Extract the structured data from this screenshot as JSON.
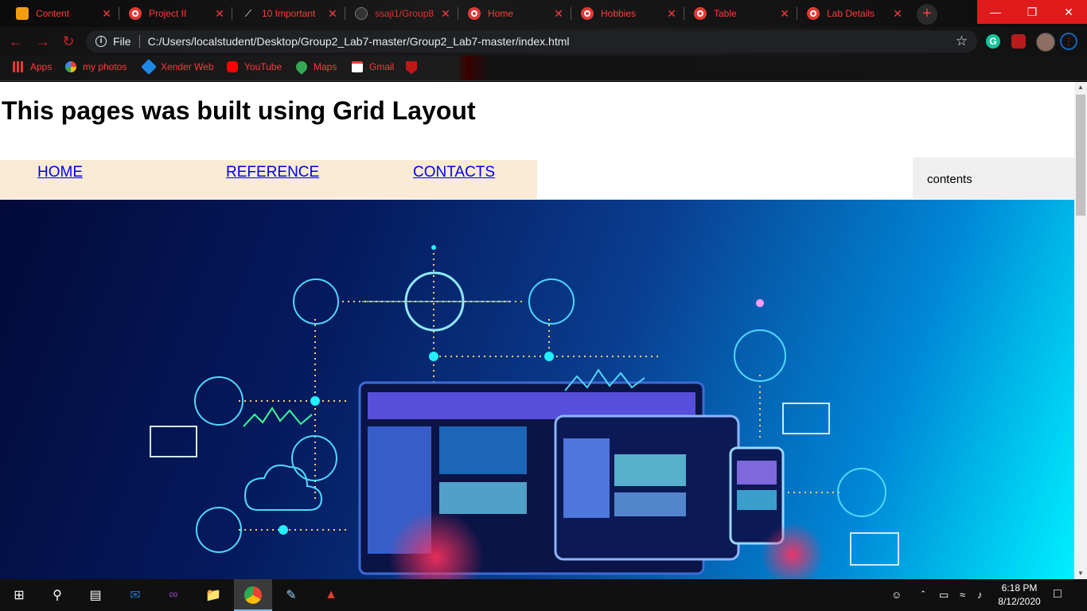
{
  "browser": {
    "tabs": [
      {
        "label": "Content",
        "icon": "note-icon"
      },
      {
        "label": "Project II",
        "icon": "globe-icon"
      },
      {
        "label": "10 Important",
        "icon": "triangle-icon"
      },
      {
        "label": "ssaji1/Group8",
        "icon": "github-icon"
      },
      {
        "label": "Home",
        "icon": "globe-icon"
      },
      {
        "label": "Hobbies",
        "icon": "globe-icon"
      },
      {
        "label": "Table",
        "icon": "globe-icon"
      },
      {
        "label": "Lab Details",
        "icon": "globe-icon"
      }
    ],
    "close_glyph": "✕",
    "new_tab_glyph": "+",
    "address": {
      "scheme_label": "File",
      "url": "C:/Users/localstudent/Desktop/Group2_Lab7-master/Group2_Lab7-master/index.html"
    },
    "bookmarks": [
      {
        "label": "Apps",
        "icon": "apps-icon"
      },
      {
        "label": "my photos",
        "icon": "photos-icon"
      },
      {
        "label": "Xender Web",
        "icon": "xender-icon"
      },
      {
        "label": "YouTube",
        "icon": "youtube-icon"
      },
      {
        "label": "Maps",
        "icon": "maps-icon"
      },
      {
        "label": "Gmail",
        "icon": "gmail-icon"
      }
    ],
    "accent_color": "#ff3b3b"
  },
  "page": {
    "title": "This pages was built using Grid Layout",
    "nav": {
      "home": "HOME",
      "reference": "REFERENCE",
      "contacts": "CONTACTS"
    },
    "aside_text": "contents",
    "nav_background": "#faebd7",
    "aside_background": "#efefef"
  },
  "taskbar": {
    "time": "6:18 PM",
    "date": "8/12/2020"
  }
}
